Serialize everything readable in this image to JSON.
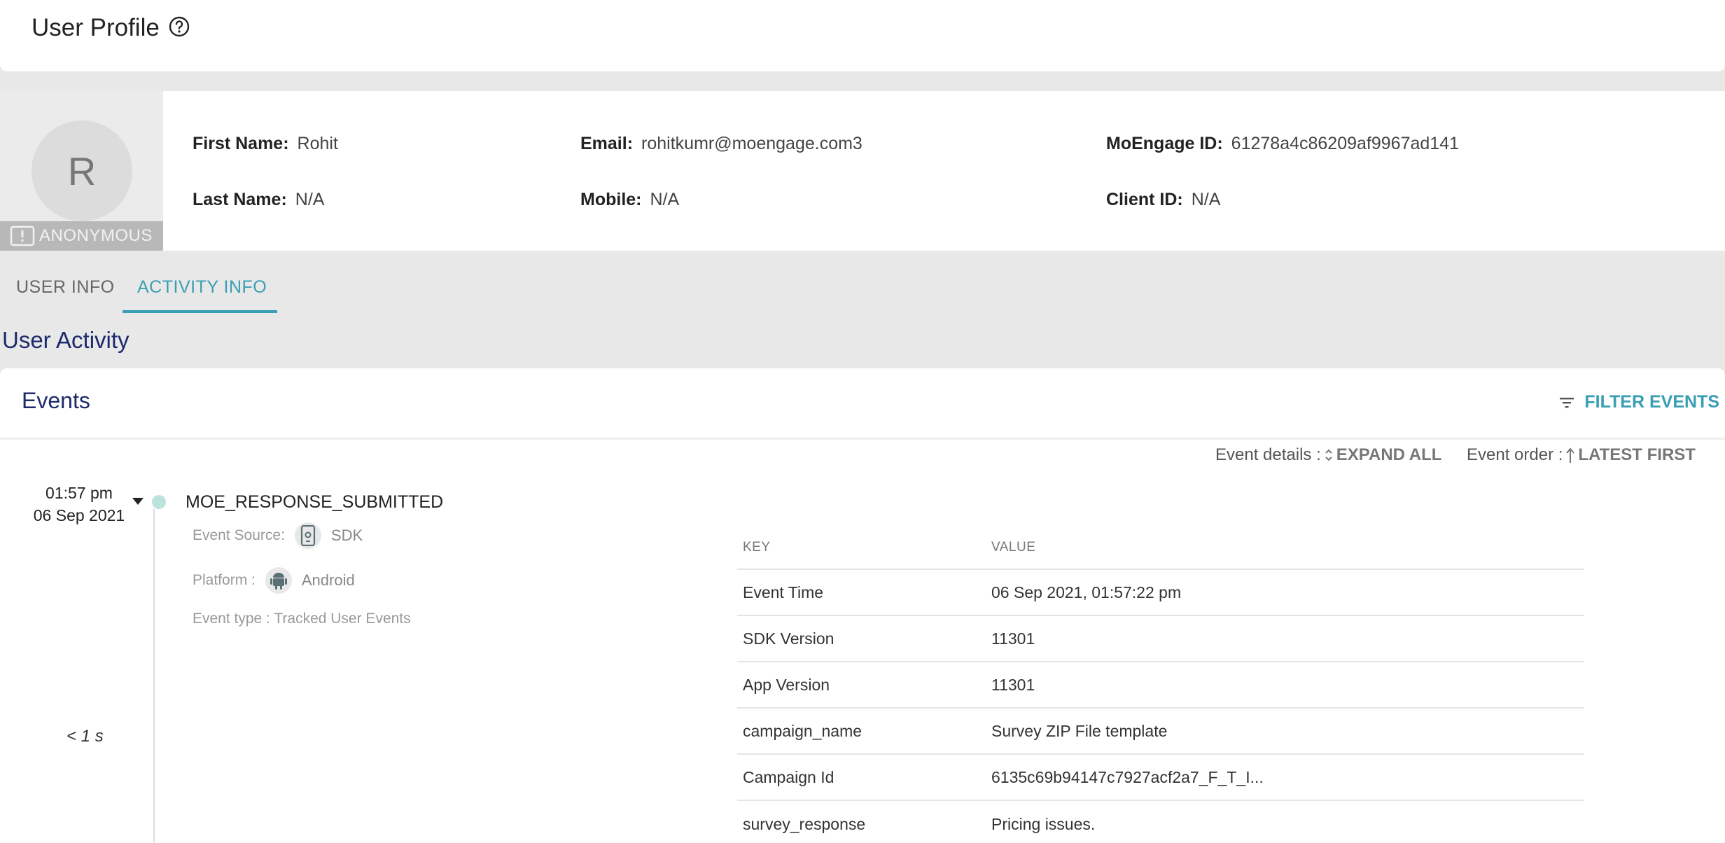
{
  "header": {
    "title": "User Profile"
  },
  "profile": {
    "avatar_initial": "R",
    "anonymous_label": "ANONYMOUS",
    "fields": {
      "first_name": {
        "label": "First Name:",
        "value": "Rohit"
      },
      "last_name": {
        "label": "Last Name:",
        "value": "N/A"
      },
      "email": {
        "label": "Email:",
        "value": "rohitkumr@moengage.com3"
      },
      "mobile": {
        "label": "Mobile:",
        "value": "N/A"
      },
      "moengage_id": {
        "label": "MoEngage ID:",
        "value": "61278a4c86209af9967ad141"
      },
      "client_id": {
        "label": "Client ID:",
        "value": "N/A"
      }
    }
  },
  "tabs": [
    {
      "label": "USER INFO",
      "active": false
    },
    {
      "label": "ACTIVITY INFO",
      "active": true
    }
  ],
  "section_title": "User Activity",
  "events": {
    "title": "Events",
    "filter_label": "FILTER EVENTS",
    "details_label": "Event details :",
    "expand_label": "EXPAND ALL",
    "order_label": "Event order :",
    "order_value": "LATEST FIRST",
    "items": [
      {
        "time": "01:57 pm",
        "date": "06 Sep 2021",
        "name": "MOE_RESPONSE_SUBMITTED",
        "source_label": "Event Source:",
        "source_value": "SDK",
        "platform_label": "Platform :",
        "platform_value": "Android",
        "type_text": "Event type : Tracked User Events",
        "duration": "< 1 s",
        "table": {
          "key_header": "KEY",
          "value_header": "VALUE",
          "rows": [
            {
              "key": "Event Time",
              "value": "06 Sep 2021, 01:57:22 pm"
            },
            {
              "key": "SDK Version",
              "value": "11301"
            },
            {
              "key": "App Version",
              "value": "11301"
            },
            {
              "key": "campaign_name",
              "value": "Survey ZIP File template"
            },
            {
              "key": "Campaign Id",
              "value": "6135c69b94147c7927acf2a7_F_T_I..."
            },
            {
              "key": "survey_response",
              "value": "Pricing issues."
            }
          ]
        }
      }
    ]
  },
  "colors": {
    "accent": "#3a9fb4",
    "heading": "#1c2a6b"
  }
}
